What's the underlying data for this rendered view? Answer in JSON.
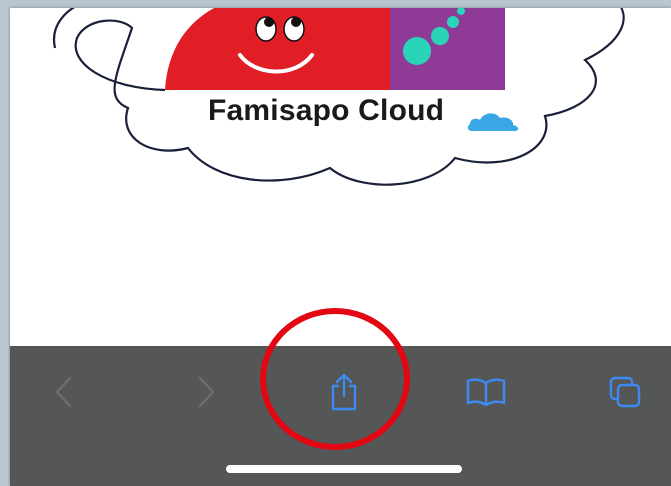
{
  "logo": {
    "brand_text": "Famisapo Cloud",
    "cloud_icon": "cloud-icon"
  },
  "toolbar": {
    "items": [
      {
        "name": "back",
        "icon": "chevron-left-icon",
        "enabled": false
      },
      {
        "name": "forward",
        "icon": "chevron-right-icon",
        "enabled": false
      },
      {
        "name": "share",
        "icon": "share-icon",
        "enabled": true,
        "highlighted": true
      },
      {
        "name": "bookmarks",
        "icon": "book-icon",
        "enabled": true
      },
      {
        "name": "tabs",
        "icon": "tabs-icon",
        "enabled": true
      }
    ],
    "accent_color": "#3d8bf2",
    "disabled_color": "#6c6d6e",
    "background_color": "#555656",
    "highlight_color": "#e30613"
  }
}
